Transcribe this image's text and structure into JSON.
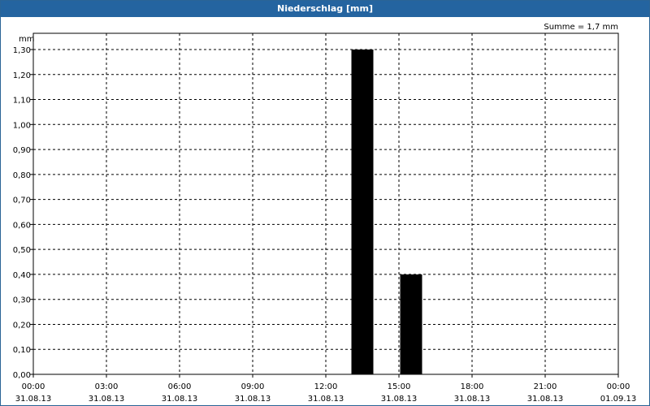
{
  "title": "Niederschlag [mm]",
  "chart_data": {
    "type": "bar",
    "title": "Niederschlag [mm]",
    "ylabel": "mm",
    "annotation": "Summe = 1,7 mm",
    "ylim": [
      0,
      1.3
    ],
    "y_ticks": [
      "0,00",
      "0,10",
      "0,20",
      "0,30",
      "0,40",
      "0,50",
      "0,60",
      "0,70",
      "0,80",
      "0,90",
      "1,00",
      "1,10",
      "1,20",
      "1,30"
    ],
    "x_range_hours": [
      0,
      24
    ],
    "x_ticks": [
      {
        "time": "00:00",
        "date": "31.08.13"
      },
      {
        "time": "03:00",
        "date": "31.08.13"
      },
      {
        "time": "06:00",
        "date": "31.08.13"
      },
      {
        "time": "09:00",
        "date": "31.08.13"
      },
      {
        "time": "12:00",
        "date": "31.08.13"
      },
      {
        "time": "15:00",
        "date": "31.08.13"
      },
      {
        "time": "18:00",
        "date": "31.08.13"
      },
      {
        "time": "21:00",
        "date": "31.08.13"
      },
      {
        "time": "00:00",
        "date": "01.09.13"
      }
    ],
    "bars": [
      {
        "start": "13:00",
        "end": "14:00",
        "value": 1.3
      },
      {
        "start": "15:00",
        "end": "16:00",
        "value": 0.4
      }
    ],
    "grid": true,
    "bar_color": "#000000"
  }
}
